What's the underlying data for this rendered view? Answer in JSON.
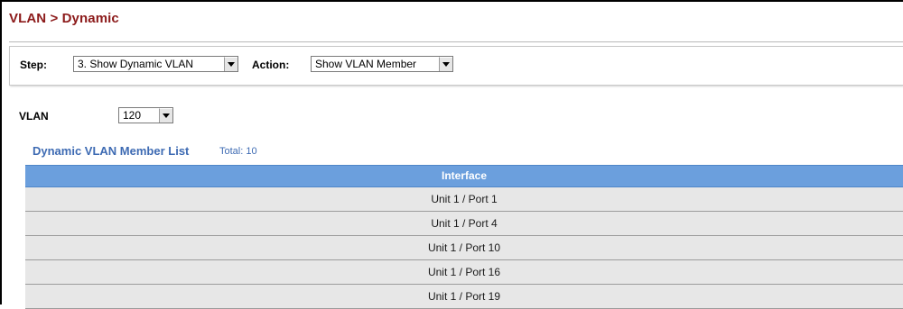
{
  "header": {
    "title": "VLAN > Dynamic"
  },
  "step_bar": {
    "step_label": "Step:",
    "step_value": "3. Show Dynamic VLAN",
    "action_label": "Action:",
    "action_value": "Show VLAN Member"
  },
  "vlan": {
    "label": "VLAN",
    "value": "120"
  },
  "member_list": {
    "title": "Dynamic VLAN Member List",
    "total": "Total: 10",
    "column_header": "Interface",
    "rows": [
      "Unit 1 / Port 1",
      "Unit 1 / Port 4",
      "Unit 1 / Port 10",
      "Unit 1 / Port 16",
      "Unit 1 / Port 19"
    ]
  },
  "colors": {
    "title": "#8c1a1a",
    "accent": "#3e6bb3",
    "table_header": "#6b9fdd",
    "row_background": "#e7e7e7"
  }
}
